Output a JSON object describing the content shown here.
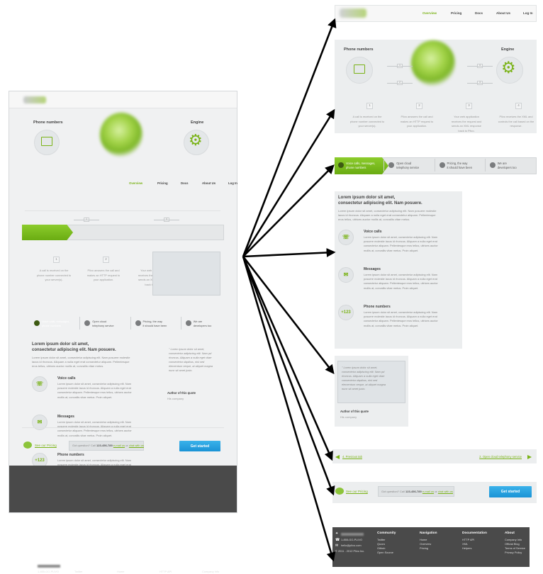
{
  "nav": {
    "links": [
      "Overview",
      "Pricing",
      "Docs",
      "About Us",
      "Log In"
    ]
  },
  "diagram": {
    "left_title": "Phone numbers",
    "right_title": "Engine",
    "arrow_steps": [
      "1",
      "2",
      "3",
      "4"
    ],
    "steps": [
      {
        "num": "1",
        "text": [
          "A call is received on the",
          "phone number connected to",
          "your server(s)."
        ]
      },
      {
        "num": "2",
        "text": [
          "Plivo answers the call and",
          "makes an HTTP request to",
          "your application."
        ]
      },
      {
        "num": "3",
        "text": [
          "Your web application",
          "receives the request and",
          "sends an XML response",
          "back to Plivo."
        ]
      },
      {
        "num": "4",
        "text": [
          "Plivo receives the XML and",
          "controls the call based on the",
          "response."
        ]
      }
    ]
  },
  "tabs": [
    {
      "label": [
        "Voice calls, messages,",
        "phone numbers"
      ],
      "active": true
    },
    {
      "label": [
        "Open cloud",
        "telephony service"
      ],
      "active": false
    },
    {
      "label": [
        "Pricing, the way",
        "it should have been"
      ],
      "active": false
    },
    {
      "label": [
        "We are",
        "developers too"
      ],
      "active": false
    }
  ],
  "content": {
    "heading": [
      "Lorem ipsum dolor sit amet,",
      "consectetur adipiscing elit. Nam posuere."
    ],
    "intro": [
      "Lorem ipsum dolor sit amet, consectetur adipiscing elit. Nam posuere molestie",
      "lacus id rhoncus. Aliquam a nulla eget erat consectetur aliquam. Pellentesque",
      "eros tellus, ultrices auctor mollis at, convallis vitae metus."
    ],
    "features": [
      {
        "title": "Voice calls",
        "icon": "phone-icon",
        "text": [
          "Lorem ipsum dolor sit amet, consectetur adipiscing elit. Nam",
          "posuere molestie lacus id rhoncus. Aliquam a nulla eget erat",
          "consectetur aliquam. Pellentesque eros tellus, ultrices auctor",
          "mollis at, convallis vitae metus. Proin aliquet."
        ]
      },
      {
        "title": "Messages",
        "icon": "envelope-icon",
        "text": [
          "Lorem ipsum dolor sit amet, consectetur adipiscing elit. Nam",
          "posuere molestie lacus id rhoncus. Aliquam a nulla eget erat",
          "consectetur aliquam. Pellentesque eros tellus, ultrices auctor",
          "mollis at, convallis vitae metus. Proin aliquet."
        ]
      },
      {
        "title": "Phone numbers",
        "icon": "+123",
        "text": [
          "Lorem ipsum dolor sit amet, consectetur adipiscing elit. Nam",
          "posuere molestie lacus id rhoncus. Aliquam a nulla eget erat",
          "consectetur aliquam. Pellentesque eros tellus, ultrices auctor",
          "mollis at, convallis vitae metus. Proin aliquet."
        ]
      }
    ]
  },
  "quote": {
    "text": [
      "\" Lorem ipsum dolor sit amet,",
      "consectetur adipiscing elit. Nam pd",
      "rhoncus. Aliquam a nulla eget vitae",
      "consectetur dapibus, nisl sed",
      "elementum neque, at aliquet magna",
      "nunc sit amet justo."
    ],
    "author": "Author of this quote",
    "company": "His company"
  },
  "pager": {
    "prev": "4. Previous tab",
    "next": "2. Open cloud telephony service"
  },
  "cta": {
    "pricing_link": "See our Pricing",
    "question_prefix": "Got question? Call ",
    "phone": "123-456-789",
    "email_link": "e-mail us",
    "or": " or ",
    "chat_link": "chat with us",
    "button": "Get started"
  },
  "footer": {
    "contact": [
      "1-855-GO-PLIVO",
      "hello@plivo.com",
      "© 2011 - 2012 Plivo Inc."
    ],
    "columns": [
      {
        "title": "Community",
        "links": [
          "Twitter",
          "Quora",
          "Github",
          "Open Source"
        ]
      },
      {
        "title": "Navigation",
        "links": [
          "Home",
          "Overview",
          "Pricing"
        ]
      },
      {
        "title": "Documentation",
        "links": [
          "HTTP API",
          "XML",
          "Helpers"
        ]
      },
      {
        "title": "About",
        "links": [
          "Company Info",
          "Official Blog",
          "Terms of Service",
          "Privacy Policy"
        ]
      }
    ]
  },
  "colors": {
    "accent": "#7ab317",
    "button": "#1f98db",
    "footer": "#4a4a4a"
  }
}
